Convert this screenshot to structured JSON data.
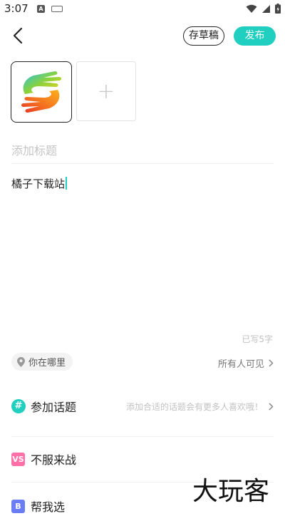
{
  "status_bar": {
    "time": "3:07",
    "notif_letter": "A"
  },
  "header": {
    "draft_label": "存草稿",
    "publish_label": "发布"
  },
  "images": {
    "add_symbol": "+"
  },
  "title": {
    "placeholder": "添加标题",
    "value": ""
  },
  "content": {
    "text": "橘子下载站"
  },
  "word_count": "已写5字",
  "location": {
    "label": "你在哪里"
  },
  "visibility": {
    "label": "所有人可见"
  },
  "topic": {
    "icon_glyph": "#",
    "label": "参加话题",
    "hint": "添加合适的话题会有更多人喜欢哦！"
  },
  "rows": [
    {
      "label": "不服来战",
      "icon_glyph": "VS"
    },
    {
      "label": "帮我选",
      "icon_glyph": "B"
    }
  ],
  "watermark": "大玩客",
  "colors": {
    "accent": "#20cfc0",
    "vs_icon": "#ff6fa8",
    "help_icon": "#6a7df5"
  }
}
